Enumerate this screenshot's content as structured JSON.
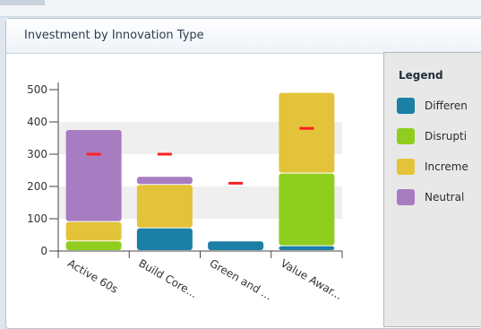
{
  "panel": {
    "title": "Investment by Innovation Type"
  },
  "legend": {
    "title": "Legend",
    "items": [
      {
        "label": "Differen",
        "color": "#1b7fa6"
      },
      {
        "label": "Disrupti",
        "color": "#8fce1e"
      },
      {
        "label": "Increme",
        "color": "#e3c33a"
      },
      {
        "label": "Neutral",
        "color": "#a77cc1"
      }
    ]
  },
  "chart_data": {
    "type": "bar",
    "stacked": true,
    "title": "Investment by Innovation Type",
    "categories": [
      "Active 60s",
      "Build Core...",
      "Green and ...",
      "Value Awar..."
    ],
    "series": [
      {
        "name": "Differen",
        "color": "#1b7fa6",
        "values": [
          0,
          70,
          30,
          15
        ]
      },
      {
        "name": "Disrupti",
        "color": "#8fce1e",
        "values": [
          30,
          0,
          0,
          225
        ]
      },
      {
        "name": "Increme",
        "color": "#e3c33a",
        "values": [
          60,
          135,
          0,
          250
        ]
      },
      {
        "name": "Neutral",
        "color": "#a77cc1",
        "values": [
          285,
          25,
          0,
          0
        ]
      }
    ],
    "markers": {
      "color": "#ff2020",
      "values": [
        300,
        300,
        210,
        380
      ]
    },
    "yticks": [
      0,
      100,
      200,
      300,
      400,
      500
    ],
    "ylim": [
      0,
      500
    ],
    "xlabel": "",
    "ylabel": "",
    "grid": "alternating bands",
    "legend_position": "right"
  }
}
